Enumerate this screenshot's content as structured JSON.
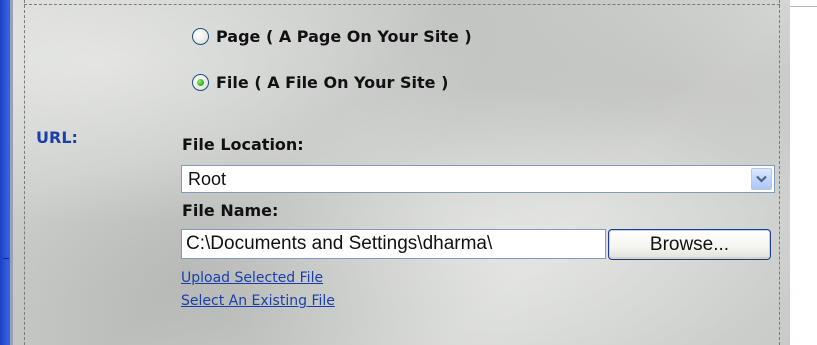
{
  "link_type": {
    "options": [
      {
        "label": "Page ( A Page On Your Site )",
        "checked": false
      },
      {
        "label": "File ( A File On Your Site )",
        "checked": true
      }
    ]
  },
  "url": {
    "label": "URL:"
  },
  "file_location": {
    "label": "File Location:",
    "selected_value": "Root",
    "arrow_icon": "chevron-down-icon"
  },
  "file_name": {
    "label": "File Name:",
    "value": "C:\\Documents and Settings\\dharma\\",
    "browse_label": "Browse..."
  },
  "actions": {
    "upload_label": "Upload Selected File",
    "select_existing_label": "Select An Existing File"
  },
  "colors": {
    "accent_bar": "#2b56d8",
    "link": "#1a3faa",
    "url_label": "#1c3fa8",
    "radio_checked": "#3bb51f"
  }
}
